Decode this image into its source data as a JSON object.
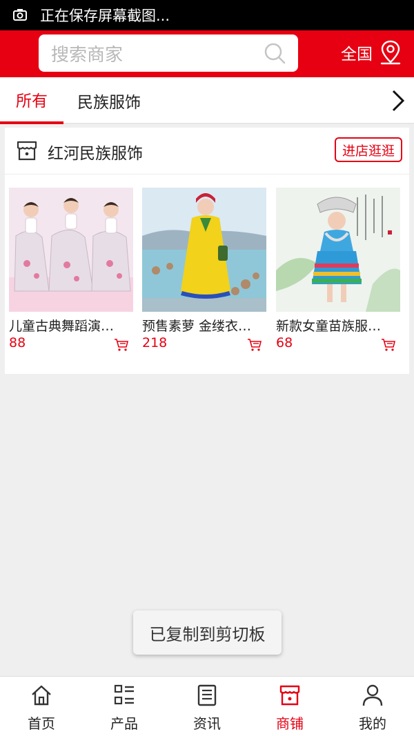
{
  "status_bar": {
    "text": "正在保存屏幕截图..."
  },
  "header": {
    "search_placeholder": "搜索商家",
    "region_label": "全国",
    "accent_color": "#e60012"
  },
  "tabs": [
    {
      "label": "所有",
      "active": true
    },
    {
      "label": "民族服饰",
      "active": false
    }
  ],
  "shop": {
    "name": "红河民族服饰",
    "visit_label": "进店逛逛",
    "products": [
      {
        "name": "儿童古典舞蹈演…",
        "price": "88"
      },
      {
        "name": "预售素萝 金缕衣…",
        "price": "218"
      },
      {
        "name": "新款女童苗族服…",
        "price": "68"
      }
    ]
  },
  "toast": {
    "text": "已复制到剪切板"
  },
  "bottom_nav": [
    {
      "label": "首页",
      "icon": "home-icon",
      "active": false
    },
    {
      "label": "产品",
      "icon": "product-grid-icon",
      "active": false
    },
    {
      "label": "资讯",
      "icon": "news-icon",
      "active": false
    },
    {
      "label": "商铺",
      "icon": "store-icon",
      "active": true
    },
    {
      "label": "我的",
      "icon": "user-icon",
      "active": false
    }
  ]
}
